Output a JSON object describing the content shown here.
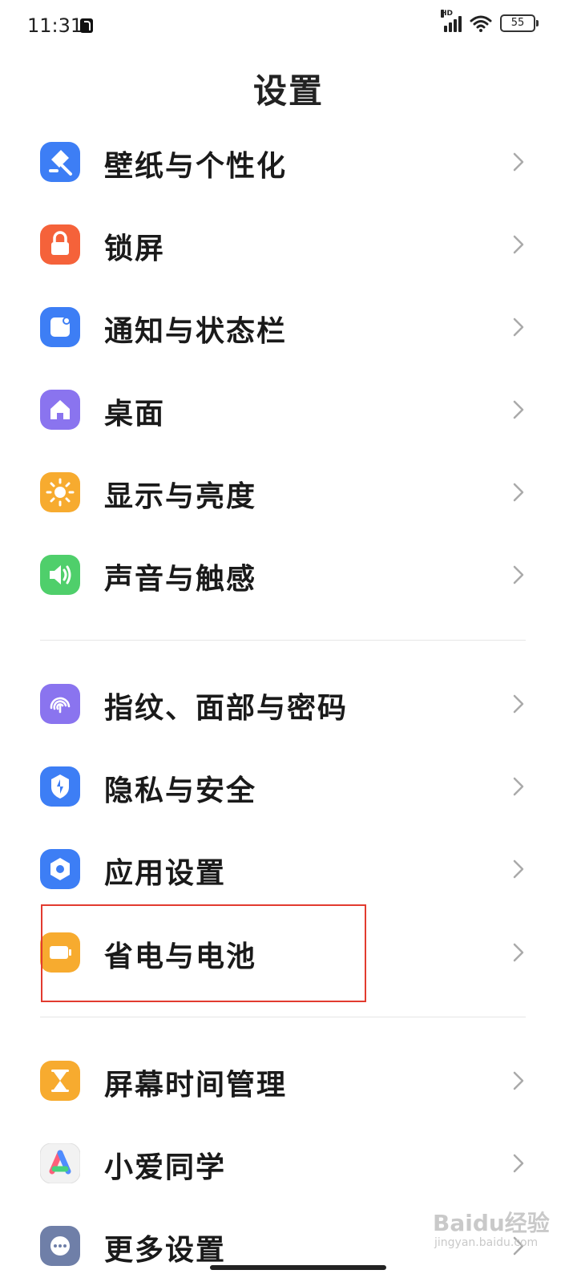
{
  "status_bar": {
    "time": "11:31",
    "network_tag": "HD",
    "battery_level": "55"
  },
  "page_title": "设置",
  "settings_items": [
    {
      "label": "壁纸与个性化",
      "icon": "wallpaper-brush-icon",
      "color": "#3d7ef5"
    },
    {
      "label": "锁屏",
      "icon": "lock-icon",
      "color": "#f5623a"
    },
    {
      "label": "通知与状态栏",
      "icon": "notification-icon",
      "color": "#3d7ef5"
    },
    {
      "label": "桌面",
      "icon": "home-icon",
      "color": "#8a74ef"
    },
    {
      "label": "显示与亮度",
      "icon": "sun-icon",
      "color": "#f7ab2f"
    },
    {
      "label": "声音与触感",
      "icon": "speaker-icon",
      "color": "#4fcf6b"
    },
    {
      "label": "指纹、面部与密码",
      "icon": "fingerprint-icon",
      "color": "#8a74ef"
    },
    {
      "label": "隐私与安全",
      "icon": "privacy-shield-icon",
      "color": "#3d7ef5"
    },
    {
      "label": "应用设置",
      "icon": "app-hexagon-icon",
      "color": "#3d7ef5"
    },
    {
      "label": "省电与电池",
      "icon": "battery-icon",
      "color": "#f7ab2f"
    },
    {
      "label": "屏幕时间管理",
      "icon": "hourglass-icon",
      "color": "#f7ab2f"
    },
    {
      "label": "小爱同学",
      "icon": "xiaoai-assistant-icon",
      "color": "#f2f2f2"
    },
    {
      "label": "更多设置",
      "icon": "more-dots-icon",
      "color": "#6f7fa8"
    }
  ],
  "watermark": {
    "brand": "Baidu经验",
    "url": "jingyan.baidu.com"
  }
}
